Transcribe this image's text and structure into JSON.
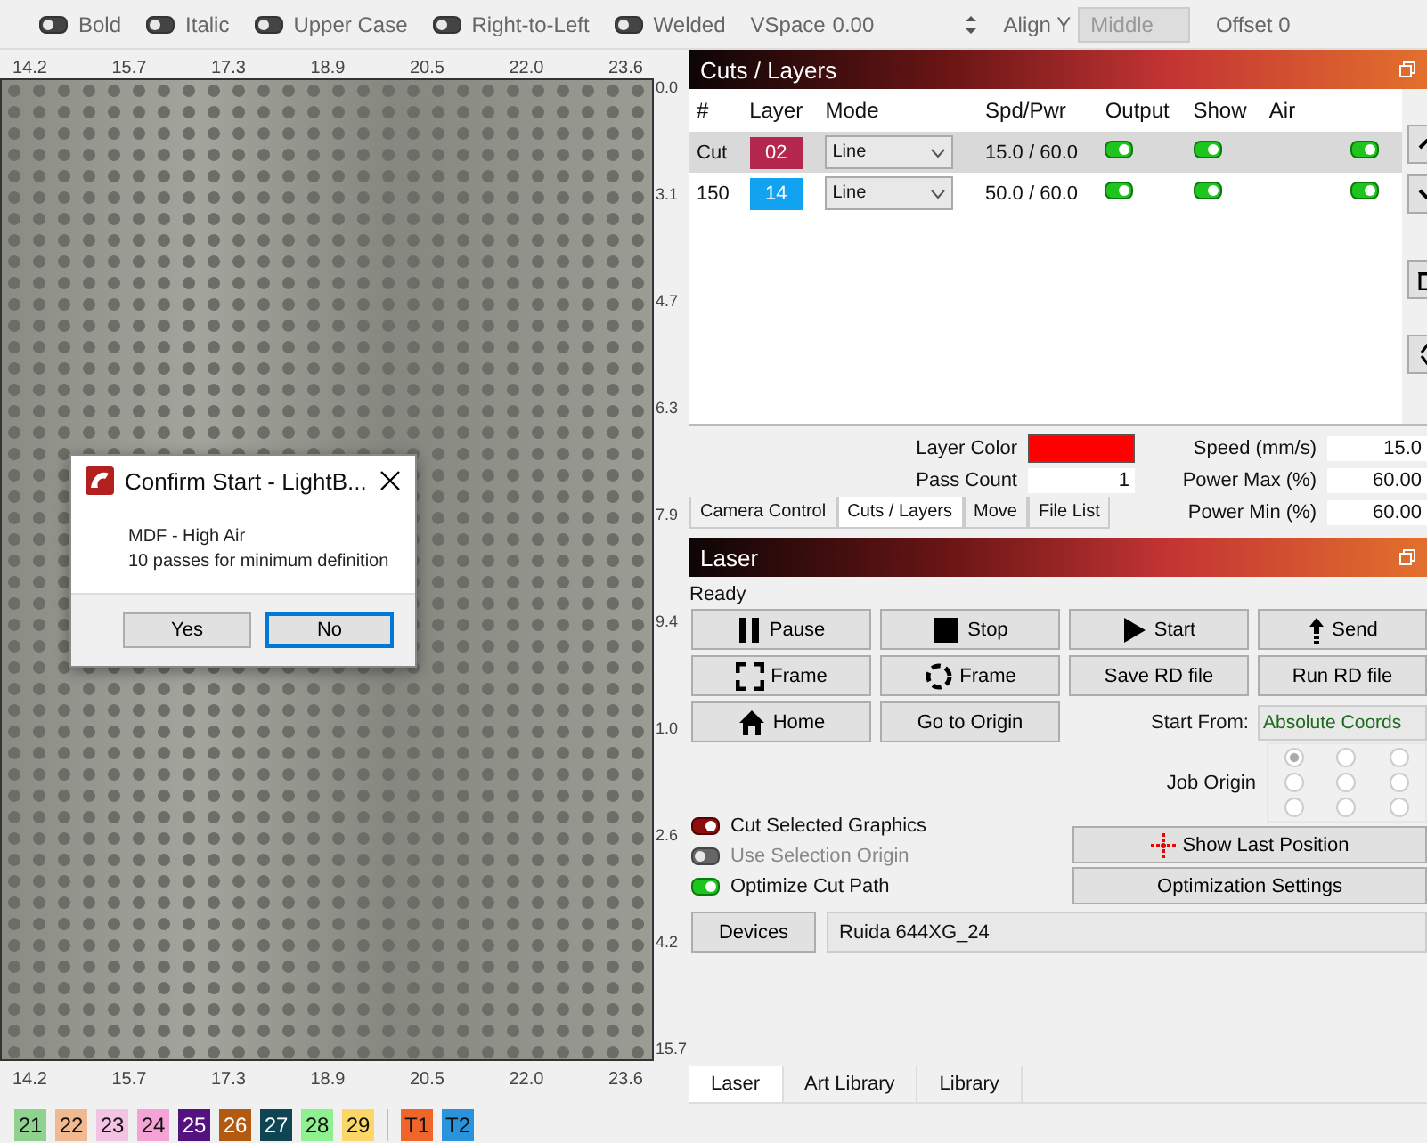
{
  "toolbar": {
    "toggles": [
      {
        "label": "Bold",
        "on": false
      },
      {
        "label": "Italic",
        "on": false
      },
      {
        "label": "Upper Case",
        "on": false
      },
      {
        "label": "Right-to-Left",
        "on": false
      },
      {
        "label": "Welded",
        "on": false
      }
    ],
    "vspace": {
      "label": "VSpace",
      "value": "0.00"
    },
    "align_y": {
      "label": "Align Y",
      "value": "Middle",
      "disabled": true
    },
    "offset": {
      "label": "Offset",
      "value": "0"
    }
  },
  "canvas": {
    "x_ruler": [
      "14.2",
      "15.7",
      "17.3",
      "18.9",
      "20.5",
      "22.0",
      "23.6"
    ],
    "y_ruler": [
      "0.0",
      "3.1",
      "4.7",
      "6.3",
      "7.9",
      "9.4",
      "1.0",
      "2.6",
      "4.2",
      "15.7"
    ],
    "bottom_ruler": [
      "14.2",
      "15.7",
      "17.3",
      "18.9",
      "20.5",
      "22.0",
      "23.6"
    ]
  },
  "dialog": {
    "title": "Confirm Start - LightB...",
    "lines": [
      "MDF - High Air",
      "10 passes for minimum definition"
    ],
    "buttons": [
      {
        "label": "Yes",
        "focused": false
      },
      {
        "label": "No",
        "focused": true
      }
    ]
  },
  "cuts_layers": {
    "title": "Cuts / Layers",
    "columns": [
      "#",
      "Layer",
      "Mode",
      "Spd/Pwr",
      "Output",
      "Show",
      "Air"
    ],
    "rows": [
      {
        "number": "Cut",
        "layer": "02",
        "color": "#b3284c",
        "mode": "Line",
        "spd_pwr": "15.0 / 60.0",
        "output": true,
        "show": true,
        "air": true,
        "selected": true
      },
      {
        "number": "150",
        "layer": "14",
        "color": "#12a2f2",
        "mode": "Line",
        "spd_pwr": "50.0 / 60.0",
        "output": true,
        "show": true,
        "air": true,
        "selected": false
      }
    ],
    "layer_color": {
      "label": "Layer Color",
      "color": "#ff0000"
    },
    "pass_count": {
      "label": "Pass Count",
      "value": "1"
    },
    "speed": {
      "label": "Speed (mm/s)",
      "value": "15.0"
    },
    "power_max": {
      "label": "Power Max (%)",
      "value": "60.00"
    },
    "power_min": {
      "label": "Power Min (%)",
      "value": "60.00"
    }
  },
  "panel_tabs": [
    {
      "label": "Camera Control",
      "selected": false
    },
    {
      "label": "Cuts / Layers",
      "selected": true
    },
    {
      "label": "Move",
      "selected": false
    },
    {
      "label": "File List",
      "selected": false
    }
  ],
  "laser": {
    "title": "Laser",
    "status": "Ready",
    "buttons": [
      {
        "label": "Pause",
        "kind": "pause"
      },
      {
        "label": "Stop",
        "kind": "stop"
      },
      {
        "label": "Start",
        "kind": "start"
      },
      {
        "label": "Send",
        "kind": "send"
      },
      {
        "label": "Frame",
        "kind": "frame"
      },
      {
        "label": "Frame",
        "kind": "circle-frame"
      },
      {
        "label": "Save RD file",
        "kind": "plain"
      },
      {
        "label": "Run RD file",
        "kind": "plain"
      },
      {
        "label": "Home",
        "kind": "home"
      },
      {
        "label": "Go to Origin",
        "kind": "plain"
      }
    ],
    "start_from": {
      "label": "Start From:",
      "value": "Absolute Coords"
    },
    "job_origin": {
      "label": "Job Origin",
      "options": [
        {
          "selected": true
        },
        {
          "selected": false
        },
        {
          "selected": false
        },
        {
          "selected": false
        },
        {
          "selected": false
        },
        {
          "selected": false
        },
        {
          "selected": false
        },
        {
          "selected": false
        },
        {
          "selected": false
        }
      ]
    },
    "options": [
      {
        "label": "Cut Selected Graphics",
        "kind": "warning",
        "on": true,
        "disabled": false
      },
      {
        "label": "Use Selection Origin",
        "kind": "normal",
        "on": false,
        "disabled": true
      },
      {
        "label": "Optimize Cut Path",
        "kind": "normal",
        "on": true,
        "disabled": false
      }
    ],
    "show_last_position": "Show Last Position",
    "optimization_settings": "Optimization Settings",
    "devices": "Devices",
    "device": "Ruida 644XG_24"
  },
  "bottom_tabs": [
    {
      "label": "Laser",
      "selected": true
    },
    {
      "label": "Art Library",
      "selected": false
    },
    {
      "label": "Library",
      "selected": false
    }
  ],
  "palette": [
    {
      "label": "21",
      "color": "#8fd18f"
    },
    {
      "label": "22",
      "color": "#f0b98f"
    },
    {
      "label": "23",
      "color": "#f3c3e3"
    },
    {
      "label": "24",
      "color": "#f5a3d6"
    },
    {
      "label": "25",
      "color": "#52137f"
    },
    {
      "label": "26",
      "color": "#b35a12"
    },
    {
      "label": "27",
      "color": "#0f4552"
    },
    {
      "label": "28",
      "color": "#8ff08f"
    },
    {
      "label": "29",
      "color": "#fbd76a"
    },
    {
      "label": "T1",
      "color": "#f0662a"
    },
    {
      "label": "T2",
      "color": "#2a93dc"
    }
  ]
}
